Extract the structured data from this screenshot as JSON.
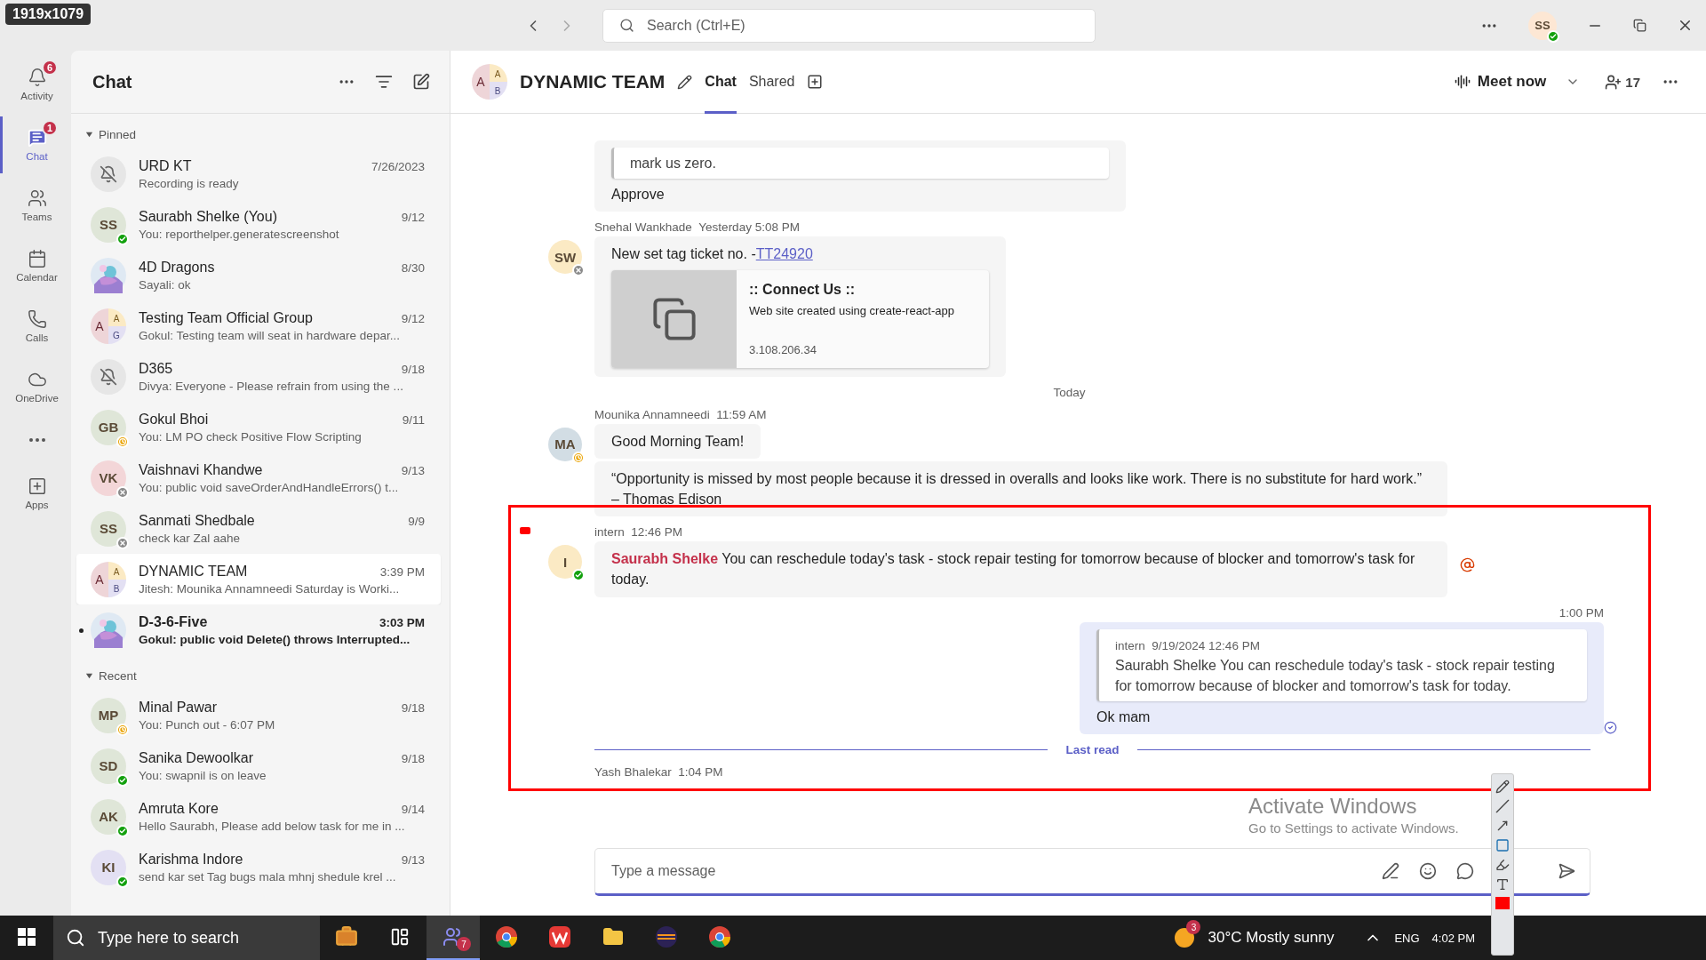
{
  "capture_badge": "1919x1079",
  "title_bar": {
    "search_placeholder": "Search (Ctrl+E)",
    "avatar": "SS",
    "presence": {
      "kind": "available"
    }
  },
  "rail": [
    {
      "kind": "bell",
      "label": "Activity",
      "badge": "6",
      "selected": false
    },
    {
      "kind": "chat",
      "label": "Chat",
      "badge": "1",
      "selected": true
    },
    {
      "kind": "teams",
      "label": "Teams",
      "selected": false
    },
    {
      "kind": "calendar",
      "label": "Calendar",
      "selected": false
    },
    {
      "kind": "calls",
      "label": "Calls",
      "selected": false
    },
    {
      "kind": "cloud",
      "label": "OneDrive",
      "selected": false
    },
    {
      "kind": "more",
      "selected": false
    },
    {
      "kind": "apps",
      "label": "Apps",
      "selected": false
    }
  ],
  "chat_list": {
    "title": "Chat",
    "sections": [
      {
        "label": "Pinned",
        "expanded": true,
        "items": [
          {
            "kind": "muted",
            "name": "URD KT",
            "time": "7/26/2023",
            "preview": "Recording is ready",
            "selected": false,
            "unread": false
          },
          {
            "kind": "initials",
            "initials": "SS",
            "presence": {
              "kind": "available"
            },
            "name": "Saurabh Shelke (You)",
            "time": "9/12",
            "preview": "You: reporthelper.generatescreenshot",
            "selected": false,
            "unread": false
          },
          {
            "kind": "picture",
            "name": "4D Dragons",
            "time": "8/30",
            "preview": "Sayali: ok",
            "selected": false,
            "unread": false
          },
          {
            "kind": "group",
            "initials": "A",
            "sub": [
              "A",
              "G"
            ],
            "name": "Testing Team Official Group",
            "time": "9/12",
            "preview": "Gokul: Testing team will seat in hardware depar...",
            "selected": false,
            "unread": false
          },
          {
            "kind": "muted",
            "name": "D365",
            "time": "9/18",
            "preview": "Divya: Everyone - Please refrain from using the ...",
            "selected": false,
            "unread": false
          },
          {
            "kind": "initials",
            "initials": "GB",
            "presence": {
              "kind": "away"
            },
            "name": "Gokul Bhoi",
            "time": "9/11",
            "preview": "You: LM PO check Positive Flow Scripting",
            "selected": false,
            "unread": false
          },
          {
            "kind": "initials",
            "initials": "VK",
            "presence": {
              "kind": "offline"
            },
            "name": "Vaishnavi Khandwe",
            "time": "9/13",
            "preview": "You: public void saveOrderAndHandleErrors() t...",
            "selected": false,
            "unread": false
          },
          {
            "kind": "initials",
            "initials": "SS",
            "presence": {
              "kind": "offline"
            },
            "name": "Sanmati Shedbale",
            "time": "9/9",
            "preview": "check kar Zal aahe",
            "selected": false,
            "unread": false
          },
          {
            "kind": "group",
            "initials": "A",
            "sub": [
              "A",
              "B"
            ],
            "name": "DYNAMIC TEAM",
            "time": "3:39 PM",
            "preview": "Jitesh: Mounika Annamneedi  Saturday is Worki...",
            "selected": true,
            "unread": false
          },
          {
            "kind": "picture",
            "name": "D-3-6-Five",
            "time": "3:03 PM",
            "preview": "Gokul: public void Delete() throws Interrupted...",
            "selected": false,
            "unread": true
          }
        ]
      },
      {
        "label": "Recent",
        "expanded": true,
        "items": [
          {
            "kind": "initials",
            "initials": "MP",
            "presence": {
              "kind": "away"
            },
            "name": "Minal Pawar",
            "time": "9/18",
            "preview": "You: Punch out - 6:07 PM",
            "selected": false,
            "unread": false
          },
          {
            "kind": "initials",
            "initials": "SD",
            "presence": {
              "kind": "available"
            },
            "name": "Sanika Dewoolkar",
            "time": "9/18",
            "preview": "You: swapnil is on leave",
            "selected": false,
            "unread": false
          },
          {
            "kind": "initials",
            "initials": "AK",
            "presence": {
              "kind": "available"
            },
            "name": "Amruta Kore",
            "time": "9/14",
            "preview": "Hello Saurabh, Please add below task for me in ...",
            "selected": false,
            "unread": false
          },
          {
            "kind": "initials",
            "initials": "KI",
            "presence": {
              "kind": "available"
            },
            "name": "Karishma Indore",
            "time": "9/13",
            "preview": "send kar set Tag bugs mala mhnj shedule krel ...",
            "selected": false,
            "unread": false
          }
        ]
      }
    ]
  },
  "header": {
    "initials": "A",
    "sub": [
      "A",
      "B"
    ],
    "title": "DYNAMIC TEAM",
    "tabs": [
      {
        "label": "Chat",
        "selected": true
      },
      {
        "label": "Shared",
        "selected": false
      }
    ],
    "meet": "Meet now",
    "participants": "17"
  },
  "messages": [
    {
      "kind": "incoming",
      "bubbles": [
        {
          "quote": {
            "text": "mark us zero."
          },
          "text": "Approve"
        }
      ]
    },
    {
      "kind": "incoming",
      "author": "Snehal Wankhade",
      "time": "Yesterday 5:08 PM",
      "initials": "SW",
      "color": "#fbeac4",
      "presence": {
        "kind": "offline"
      },
      "bubbles": [
        {
          "text": "New  set tag  ticket no. -",
          "link": "TT24920",
          "card": {
            "title": ":: Connect Us ::",
            "description": "Web site created using create-react-app",
            "url": "3.108.206.34"
          }
        }
      ]
    },
    {
      "kind": "date",
      "text": "Today"
    },
    {
      "kind": "incoming",
      "author": "Mounika Annamneedi",
      "time": "11:59 AM",
      "initials": "MA",
      "color": "#d2dde4",
      "presence": {
        "kind": "away"
      },
      "bubbles": [
        {
          "text": "Good Morning Team!"
        },
        {
          "text": "“Opportunity is missed by most people because it is dressed in overalls and looks like work. There is no substitute for hard work.”  – Thomas Edison"
        }
      ]
    },
    {
      "kind": "incoming",
      "author": "intern",
      "time": "12:46 PM",
      "initials": "I",
      "color": "#fbeac4",
      "presence": {
        "kind": "available"
      },
      "mentioned": true,
      "bubbles": [
        {
          "mention": "Saurabh Shelke",
          "text": " You  can reschedule today's task - stock repair testing for tomorrow because of blocker and tomorrow's task for today."
        }
      ]
    },
    {
      "kind": "outgoing",
      "time": "1:00 PM",
      "seen": true,
      "bubbles": [
        {
          "quote": {
            "author": "intern",
            "time": "9/19/2024 12:46 PM",
            "text": "Saurabh Shelke You  can reschedule today's task - stock repair testing for tomorrow because of blocker and tomorrow's task for today."
          },
          "text": "Ok mam"
        }
      ]
    },
    {
      "kind": "divider",
      "text": "Last read"
    },
    {
      "kind": "incoming",
      "author": "Yash Bhalekar",
      "time": "1:04 PM"
    }
  ],
  "composer": {
    "placeholder": "Type a message"
  },
  "windows_notice": {
    "title": "Activate Windows",
    "text": "Go to Settings to activate Windows."
  },
  "taskbar": {
    "search_placeholder": "Type here to search",
    "apps": [
      {
        "kind": "briefcase",
        "active": false
      },
      {
        "kind": "taskview",
        "active": false
      },
      {
        "kind": "teams",
        "badge": "7",
        "active": true
      },
      {
        "kind": "chrome",
        "active": false
      },
      {
        "kind": "office",
        "active": false
      },
      {
        "kind": "folder",
        "active": false
      },
      {
        "kind": "eclipse",
        "active": false
      },
      {
        "kind": "chrome",
        "active": false
      }
    ],
    "weather_badge": "3",
    "weather": "30°C  Mostly sunny",
    "language": "ENG",
    "clock": "4:02 PM"
  }
}
